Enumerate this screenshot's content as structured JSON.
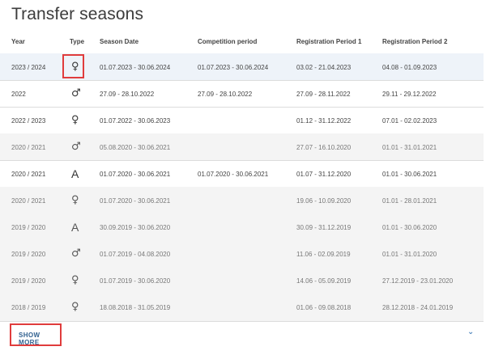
{
  "page": {
    "title": "Transfer seasons"
  },
  "table": {
    "headers": [
      "Year",
      "Type",
      "Season Date",
      "Competition period",
      "Registration Period 1",
      "Registration Period 2"
    ],
    "rows": [
      {
        "year": "2023 / 2024",
        "type_icon": "♀",
        "season": "01.07.2023 - 30.06.2024",
        "competition": "01.07.2023 - 30.06.2024",
        "reg1": "03.02 - 21.04.2023",
        "reg2": "04.08 - 01.09.2023"
      },
      {
        "year": "2022",
        "type_icon": "♂",
        "season": "27.09 - 28.10.2022",
        "competition": "27.09 - 28.10.2022",
        "reg1": "27.09 - 28.11.2022",
        "reg2": "29.11 - 29.12.2022"
      },
      {
        "year": "2022 / 2023",
        "type_icon": "♀",
        "season": "01.07.2022 - 30.06.2023",
        "competition": "",
        "reg1": "01.12 - 31.12.2022",
        "reg2": "07.01 - 02.02.2023"
      },
      {
        "year": "2020 / 2021",
        "type_icon": "♂",
        "season": "05.08.2020 - 30.06.2021",
        "competition": "",
        "reg1": "27.07 - 16.10.2020",
        "reg2": "01.01 - 31.01.2021"
      },
      {
        "year": "2020 / 2021",
        "type_icon": "A",
        "season": "01.07.2020 - 30.06.2021",
        "competition": "01.07.2020 - 30.06.2021",
        "reg1": "01.07 - 31.12.2020",
        "reg2": "01.01 - 30.06.2021"
      },
      {
        "year": "2020 / 2021",
        "type_icon": "♀",
        "season": "01.07.2020 - 30.06.2021",
        "competition": "",
        "reg1": "19.06 - 10.09.2020",
        "reg2": "01.01 - 28.01.2021"
      },
      {
        "year": "2019 / 2020",
        "type_icon": "A",
        "season": "30.09.2019 - 30.06.2020",
        "competition": "",
        "reg1": "30.09 - 31.12.2019",
        "reg2": "01.01 - 30.06.2020"
      },
      {
        "year": "2019 / 2020",
        "type_icon": "♂",
        "season": "01.07.2019 - 04.08.2020",
        "competition": "",
        "reg1": "11.06 - 02.09.2019",
        "reg2": "01.01 - 31.01.2020"
      },
      {
        "year": "2019 / 2020",
        "type_icon": "♀",
        "season": "01.07.2019 - 30.06.2020",
        "competition": "",
        "reg1": "14.06 - 05.09.2019",
        "reg2": "27.12.2019 - 23.01.2020"
      },
      {
        "year": "2018 / 2019",
        "type_icon": "♀",
        "season": "18.08.2018 - 31.05.2019",
        "competition": "",
        "reg1": "01.06 - 09.08.2018",
        "reg2": "28.12.2018 - 24.01.2019"
      }
    ]
  },
  "footer": {
    "show_more_label": "SHOW MORE",
    "expand_icon": "chevron-down-icon"
  }
}
